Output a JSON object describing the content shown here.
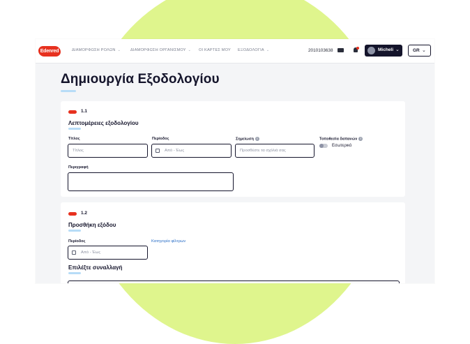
{
  "brand": {
    "logo_text": "Edenred",
    "color": "#e7311f"
  },
  "nav": {
    "items": [
      {
        "label": "ΔΙΑΜΟΡΦΩΣΗ ΡΟΛΩΝ",
        "dropdown": true
      },
      {
        "label": "ΔΙΑΜΟΡΦΩΣΗ ΟΡΓΑΝΙΣΜΟΥ",
        "dropdown": true
      },
      {
        "label": "ΟΙ ΚΑΡΤΕΣ ΜΟΥ",
        "dropdown": false
      },
      {
        "label": "ΕΞΟΔΟΛΟΓΙΑ",
        "dropdown": true
      }
    ],
    "chevron": "⌄"
  },
  "header": {
    "card_number": "2010103638",
    "card_icon": "credit-card-icon",
    "bell_icon": "bell-icon",
    "user_name": "Micheli",
    "language": "GR",
    "chevron": "⌄"
  },
  "page": {
    "title": "Δημιουργία Εξοδολογίου"
  },
  "section1": {
    "step": "1.1",
    "title": "Λεπτομέρειες εξοδολογίου",
    "fields": {
      "title_label": "Τίτλος",
      "title_placeholder": "Τίτλος",
      "period_label": "Περίοδος",
      "period_placeholder": "Από - Έως",
      "note_label": "Σημείωση",
      "note_placeholder": "Προσθέστε τα σχόλιά σας",
      "location_label": "Τοποθεσία δαπανών",
      "location_toggle_text": "Εσωτερικό",
      "description_label": "Περιγραφή",
      "info_glyph": "i"
    }
  },
  "section2": {
    "step": "1.2",
    "title": "Προσθήκη εξόδου",
    "period_label": "Περίοδος",
    "period_placeholder": "Από - Έως",
    "filter_link": "Κατηγορία φίλτρων",
    "select_title": "Επιλέξτε συναλλαγή"
  },
  "colors": {
    "accent_green": "#dff58d",
    "primary_dark": "#14142b",
    "underline_blue": "#b7dcf7",
    "link_blue": "#2b6fc7"
  }
}
